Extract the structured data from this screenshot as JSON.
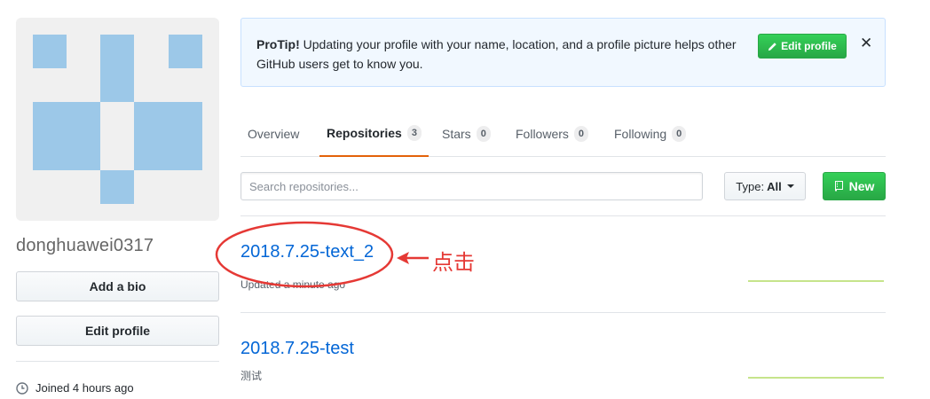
{
  "profile": {
    "username": "donghuawei0317",
    "add_bio_label": "Add a bio",
    "edit_profile_label": "Edit profile",
    "joined_text": "Joined 4 hours ago"
  },
  "protip": {
    "title": "ProTip!",
    "text": " Updating your profile with your name, location, and a profile picture helps other GitHub users get to know you.",
    "edit_profile_label": "Edit profile",
    "close_label": "✕"
  },
  "tabs": [
    {
      "label": "Overview",
      "count": null,
      "active": false
    },
    {
      "label": "Repositories",
      "count": "3",
      "active": true
    },
    {
      "label": "Stars",
      "count": "0",
      "active": false
    },
    {
      "label": "Followers",
      "count": "0",
      "active": false
    },
    {
      "label": "Following",
      "count": "0",
      "active": false
    }
  ],
  "search": {
    "placeholder": "Search repositories...",
    "value": ""
  },
  "filter": {
    "type_label": "Type:",
    "type_value": "All"
  },
  "new_button_label": "New",
  "repositories": [
    {
      "name": "2018.7.25-text_2",
      "meta": "Updated a minute ago"
    },
    {
      "name": "2018.7.25-test",
      "meta": "测试"
    }
  ],
  "annotation": {
    "text": "点击",
    "color": "#e53935"
  },
  "colors": {
    "link": "#0366d6",
    "green": "#28a745",
    "accent_tab": "#e36209",
    "avatar_blue": "#9cc8e8",
    "activity_line": "#c6e48b"
  }
}
